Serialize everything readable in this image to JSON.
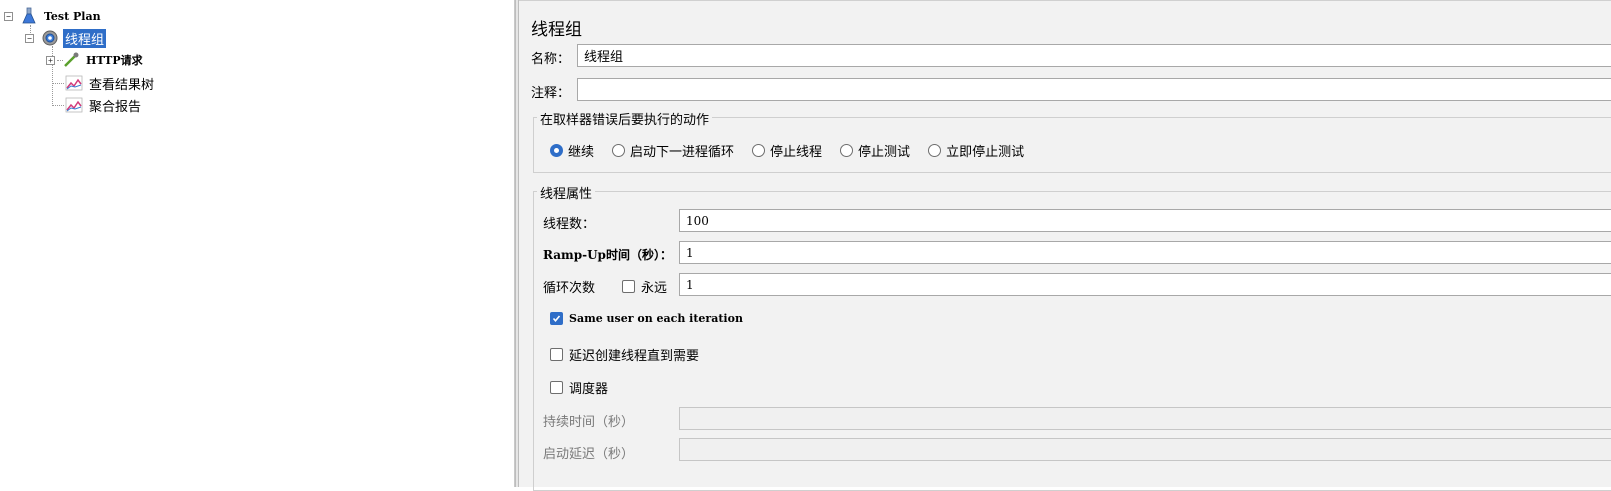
{
  "tree": {
    "root": {
      "label": "Test Plan",
      "expander": "−"
    },
    "thread_group": {
      "label": "线程组",
      "expander": "−"
    },
    "children": [
      {
        "label": "HTTP请求",
        "expander": "+"
      },
      {
        "label": "查看结果树"
      },
      {
        "label": "聚合报告"
      }
    ]
  },
  "panel": {
    "title": "线程组",
    "name_label": "名称：",
    "name_value": "线程组",
    "comment_label": "注释：",
    "comment_value": "",
    "error_action": {
      "legend": "在取样器错误后要执行的动作",
      "options": [
        "继续",
        "启动下一进程循环",
        "停止线程",
        "停止测试",
        "立即停止测试"
      ],
      "selected": "继续"
    },
    "thread_props": {
      "legend": "线程属性",
      "num_threads_label": "线程数：",
      "num_threads_value": "100",
      "rampup_label": "Ramp-Up时间（秒）：",
      "rampup_value": "1",
      "loop_label": "循环次数",
      "forever_label": "永远",
      "forever_checked": false,
      "loop_value": "1",
      "same_user_label": "Same user on each iteration",
      "same_user_checked": true,
      "delay_create_label": "延迟创建线程直到需要",
      "delay_create_checked": false,
      "scheduler_label": "调度器",
      "scheduler_checked": false,
      "duration_label": "持续时间（秒）",
      "duration_value": "",
      "startup_delay_label": "启动延迟（秒）",
      "startup_delay_value": ""
    }
  },
  "colors": {
    "selection": "#2f6ec8",
    "panel_bg": "#f2f2f2"
  }
}
